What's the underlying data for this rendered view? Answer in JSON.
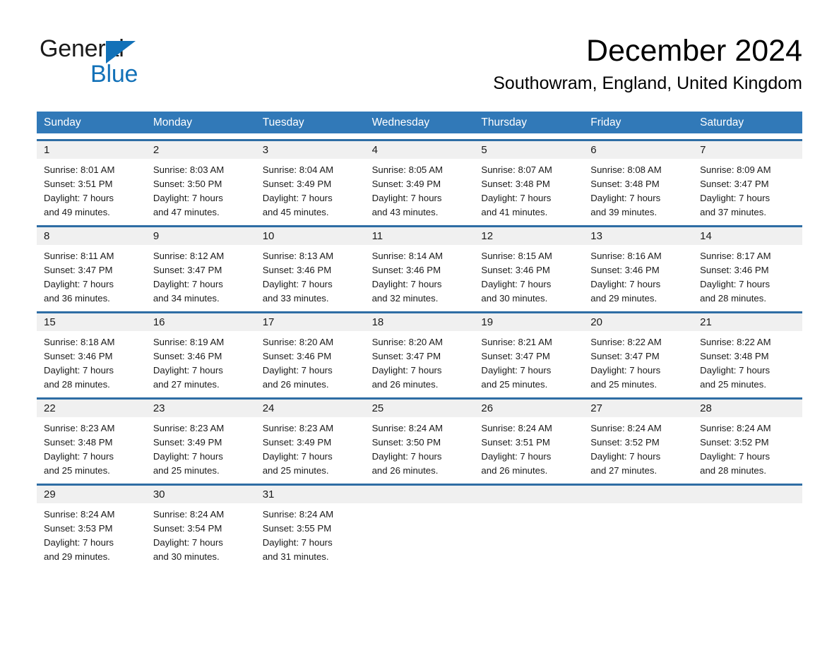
{
  "logo": {
    "word_general": "General",
    "word_blue": "Blue",
    "triangle_color": "#1271b8"
  },
  "header": {
    "title": "December 2024",
    "subtitle": "Southowram, England, United Kingdom"
  },
  "theme": {
    "header_blue": "#3179b8",
    "separator_blue": "#2e6da4",
    "day_number_bg": "#f0f0f0"
  },
  "weekdays": [
    "Sunday",
    "Monday",
    "Tuesday",
    "Wednesday",
    "Thursday",
    "Friday",
    "Saturday"
  ],
  "weeks": [
    [
      {
        "day": "1",
        "sunrise": "Sunrise: 8:01 AM",
        "sunset": "Sunset: 3:51 PM",
        "daylight_line1": "Daylight: 7 hours",
        "daylight_line2": "and 49 minutes."
      },
      {
        "day": "2",
        "sunrise": "Sunrise: 8:03 AM",
        "sunset": "Sunset: 3:50 PM",
        "daylight_line1": "Daylight: 7 hours",
        "daylight_line2": "and 47 minutes."
      },
      {
        "day": "3",
        "sunrise": "Sunrise: 8:04 AM",
        "sunset": "Sunset: 3:49 PM",
        "daylight_line1": "Daylight: 7 hours",
        "daylight_line2": "and 45 minutes."
      },
      {
        "day": "4",
        "sunrise": "Sunrise: 8:05 AM",
        "sunset": "Sunset: 3:49 PM",
        "daylight_line1": "Daylight: 7 hours",
        "daylight_line2": "and 43 minutes."
      },
      {
        "day": "5",
        "sunrise": "Sunrise: 8:07 AM",
        "sunset": "Sunset: 3:48 PM",
        "daylight_line1": "Daylight: 7 hours",
        "daylight_line2": "and 41 minutes."
      },
      {
        "day": "6",
        "sunrise": "Sunrise: 8:08 AM",
        "sunset": "Sunset: 3:48 PM",
        "daylight_line1": "Daylight: 7 hours",
        "daylight_line2": "and 39 minutes."
      },
      {
        "day": "7",
        "sunrise": "Sunrise: 8:09 AM",
        "sunset": "Sunset: 3:47 PM",
        "daylight_line1": "Daylight: 7 hours",
        "daylight_line2": "and 37 minutes."
      }
    ],
    [
      {
        "day": "8",
        "sunrise": "Sunrise: 8:11 AM",
        "sunset": "Sunset: 3:47 PM",
        "daylight_line1": "Daylight: 7 hours",
        "daylight_line2": "and 36 minutes."
      },
      {
        "day": "9",
        "sunrise": "Sunrise: 8:12 AM",
        "sunset": "Sunset: 3:47 PM",
        "daylight_line1": "Daylight: 7 hours",
        "daylight_line2": "and 34 minutes."
      },
      {
        "day": "10",
        "sunrise": "Sunrise: 8:13 AM",
        "sunset": "Sunset: 3:46 PM",
        "daylight_line1": "Daylight: 7 hours",
        "daylight_line2": "and 33 minutes."
      },
      {
        "day": "11",
        "sunrise": "Sunrise: 8:14 AM",
        "sunset": "Sunset: 3:46 PM",
        "daylight_line1": "Daylight: 7 hours",
        "daylight_line2": "and 32 minutes."
      },
      {
        "day": "12",
        "sunrise": "Sunrise: 8:15 AM",
        "sunset": "Sunset: 3:46 PM",
        "daylight_line1": "Daylight: 7 hours",
        "daylight_line2": "and 30 minutes."
      },
      {
        "day": "13",
        "sunrise": "Sunrise: 8:16 AM",
        "sunset": "Sunset: 3:46 PM",
        "daylight_line1": "Daylight: 7 hours",
        "daylight_line2": "and 29 minutes."
      },
      {
        "day": "14",
        "sunrise": "Sunrise: 8:17 AM",
        "sunset": "Sunset: 3:46 PM",
        "daylight_line1": "Daylight: 7 hours",
        "daylight_line2": "and 28 minutes."
      }
    ],
    [
      {
        "day": "15",
        "sunrise": "Sunrise: 8:18 AM",
        "sunset": "Sunset: 3:46 PM",
        "daylight_line1": "Daylight: 7 hours",
        "daylight_line2": "and 28 minutes."
      },
      {
        "day": "16",
        "sunrise": "Sunrise: 8:19 AM",
        "sunset": "Sunset: 3:46 PM",
        "daylight_line1": "Daylight: 7 hours",
        "daylight_line2": "and 27 minutes."
      },
      {
        "day": "17",
        "sunrise": "Sunrise: 8:20 AM",
        "sunset": "Sunset: 3:46 PM",
        "daylight_line1": "Daylight: 7 hours",
        "daylight_line2": "and 26 minutes."
      },
      {
        "day": "18",
        "sunrise": "Sunrise: 8:20 AM",
        "sunset": "Sunset: 3:47 PM",
        "daylight_line1": "Daylight: 7 hours",
        "daylight_line2": "and 26 minutes."
      },
      {
        "day": "19",
        "sunrise": "Sunrise: 8:21 AM",
        "sunset": "Sunset: 3:47 PM",
        "daylight_line1": "Daylight: 7 hours",
        "daylight_line2": "and 25 minutes."
      },
      {
        "day": "20",
        "sunrise": "Sunrise: 8:22 AM",
        "sunset": "Sunset: 3:47 PM",
        "daylight_line1": "Daylight: 7 hours",
        "daylight_line2": "and 25 minutes."
      },
      {
        "day": "21",
        "sunrise": "Sunrise: 8:22 AM",
        "sunset": "Sunset: 3:48 PM",
        "daylight_line1": "Daylight: 7 hours",
        "daylight_line2": "and 25 minutes."
      }
    ],
    [
      {
        "day": "22",
        "sunrise": "Sunrise: 8:23 AM",
        "sunset": "Sunset: 3:48 PM",
        "daylight_line1": "Daylight: 7 hours",
        "daylight_line2": "and 25 minutes."
      },
      {
        "day": "23",
        "sunrise": "Sunrise: 8:23 AM",
        "sunset": "Sunset: 3:49 PM",
        "daylight_line1": "Daylight: 7 hours",
        "daylight_line2": "and 25 minutes."
      },
      {
        "day": "24",
        "sunrise": "Sunrise: 8:23 AM",
        "sunset": "Sunset: 3:49 PM",
        "daylight_line1": "Daylight: 7 hours",
        "daylight_line2": "and 25 minutes."
      },
      {
        "day": "25",
        "sunrise": "Sunrise: 8:24 AM",
        "sunset": "Sunset: 3:50 PM",
        "daylight_line1": "Daylight: 7 hours",
        "daylight_line2": "and 26 minutes."
      },
      {
        "day": "26",
        "sunrise": "Sunrise: 8:24 AM",
        "sunset": "Sunset: 3:51 PM",
        "daylight_line1": "Daylight: 7 hours",
        "daylight_line2": "and 26 minutes."
      },
      {
        "day": "27",
        "sunrise": "Sunrise: 8:24 AM",
        "sunset": "Sunset: 3:52 PM",
        "daylight_line1": "Daylight: 7 hours",
        "daylight_line2": "and 27 minutes."
      },
      {
        "day": "28",
        "sunrise": "Sunrise: 8:24 AM",
        "sunset": "Sunset: 3:52 PM",
        "daylight_line1": "Daylight: 7 hours",
        "daylight_line2": "and 28 minutes."
      }
    ],
    [
      {
        "day": "29",
        "sunrise": "Sunrise: 8:24 AM",
        "sunset": "Sunset: 3:53 PM",
        "daylight_line1": "Daylight: 7 hours",
        "daylight_line2": "and 29 minutes."
      },
      {
        "day": "30",
        "sunrise": "Sunrise: 8:24 AM",
        "sunset": "Sunset: 3:54 PM",
        "daylight_line1": "Daylight: 7 hours",
        "daylight_line2": "and 30 minutes."
      },
      {
        "day": "31",
        "sunrise": "Sunrise: 8:24 AM",
        "sunset": "Sunset: 3:55 PM",
        "daylight_line1": "Daylight: 7 hours",
        "daylight_line2": "and 31 minutes."
      },
      {
        "day": "",
        "sunrise": "",
        "sunset": "",
        "daylight_line1": "",
        "daylight_line2": ""
      },
      {
        "day": "",
        "sunrise": "",
        "sunset": "",
        "daylight_line1": "",
        "daylight_line2": ""
      },
      {
        "day": "",
        "sunrise": "",
        "sunset": "",
        "daylight_line1": "",
        "daylight_line2": ""
      },
      {
        "day": "",
        "sunrise": "",
        "sunset": "",
        "daylight_line1": "",
        "daylight_line2": ""
      }
    ]
  ]
}
